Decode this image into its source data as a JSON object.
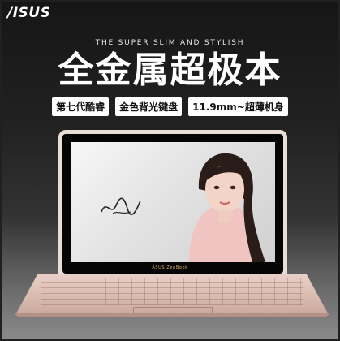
{
  "brand": {
    "logo": "/ISUS",
    "tagline": "THE SUPER  SLIM AND STYLISH"
  },
  "headline": "全金属超极本",
  "badges": [
    "第七代酷睿",
    "金色背光键盘",
    "11.9mm~超薄机身"
  ],
  "screen_brand": "ASUS ZenBook",
  "colors": {
    "background": "#1e1e1e",
    "laptop": "#dcbcb2",
    "badge_bg": "#ffffff"
  }
}
